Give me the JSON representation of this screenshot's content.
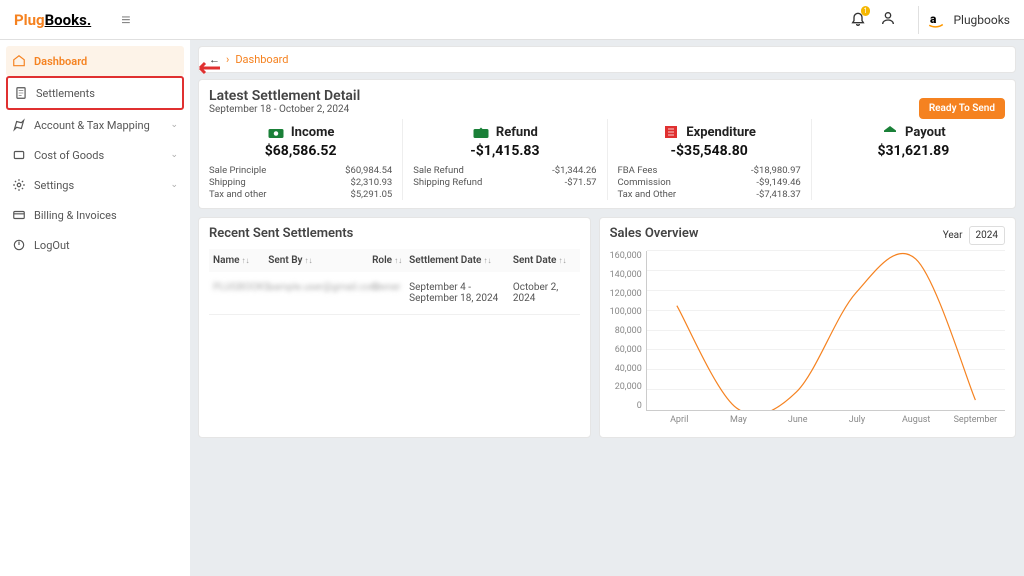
{
  "header": {
    "logo_a": "Plug",
    "logo_b": "Books.",
    "badge": "1",
    "brand_name": "Plugbooks"
  },
  "sidebar": {
    "items": [
      {
        "label": "Dashboard",
        "name": "dashboard",
        "icon": "home",
        "active": true
      },
      {
        "label": "Settlements",
        "name": "settlements",
        "icon": "doc",
        "hl": true
      },
      {
        "label": "Account & Tax Mapping",
        "name": "account",
        "icon": "map",
        "chev": true
      },
      {
        "label": "Cost of Goods",
        "name": "cogs",
        "icon": "tag",
        "chev": true
      },
      {
        "label": "Settings",
        "name": "settings",
        "icon": "gear",
        "chev": true
      },
      {
        "label": "Billing & Invoices",
        "name": "billing",
        "icon": "card"
      },
      {
        "label": "LogOut",
        "name": "logout",
        "icon": "power"
      }
    ]
  },
  "breadcrumb": {
    "link": "Dashboard"
  },
  "settle": {
    "title": "Latest Settlement Detail",
    "period": "September 18 - October 2, 2024",
    "ready": "Ready To Send",
    "income": {
      "title": "Income",
      "total": "$68,586.52",
      "lines": [
        [
          "Sale Principle",
          "$60,984.54"
        ],
        [
          "Shipping",
          "$2,310.93"
        ],
        [
          "Tax and other",
          "$5,291.05"
        ]
      ]
    },
    "refund": {
      "title": "Refund",
      "total": "-$1,415.83",
      "lines": [
        [
          "Sale Refund",
          "-$1,344.26"
        ],
        [
          "Shipping Refund",
          "-$71.57"
        ]
      ]
    },
    "expend": {
      "title": "Expenditure",
      "total": "-$35,548.80",
      "lines": [
        [
          "FBA Fees",
          "-$18,980.97"
        ],
        [
          "Commission",
          "-$9,149.46"
        ],
        [
          "Tax and Other",
          "-$7,418.37"
        ]
      ]
    },
    "payout": {
      "title": "Payout",
      "total": "$31,621.89",
      "lines": []
    }
  },
  "recent": {
    "title": "Recent Sent Settlements",
    "cols": [
      "Name",
      "Sent By",
      "Role",
      "Settlement Date",
      "Sent Date"
    ],
    "row": {
      "name": "PLUGBOOKS",
      "sent_by": "sample.user@gmail.com",
      "role": "Owner",
      "settle_date": "September 4 - September 18, 2024",
      "sent_date": "October 2, 2024"
    }
  },
  "sales": {
    "title": "Sales Overview",
    "year_label": "Year",
    "year": "2024"
  },
  "chart_data": {
    "type": "line",
    "title": "Sales Overview",
    "xlabel": "",
    "ylabel": "",
    "ylim": [
      0,
      160000
    ],
    "categories": [
      "April",
      "May",
      "June",
      "July",
      "August",
      "September"
    ],
    "values": [
      105000,
      2000,
      18000,
      118000,
      152000,
      10000
    ],
    "yticks": [
      0,
      20000,
      40000,
      60000,
      80000,
      100000,
      120000,
      140000,
      160000
    ]
  }
}
